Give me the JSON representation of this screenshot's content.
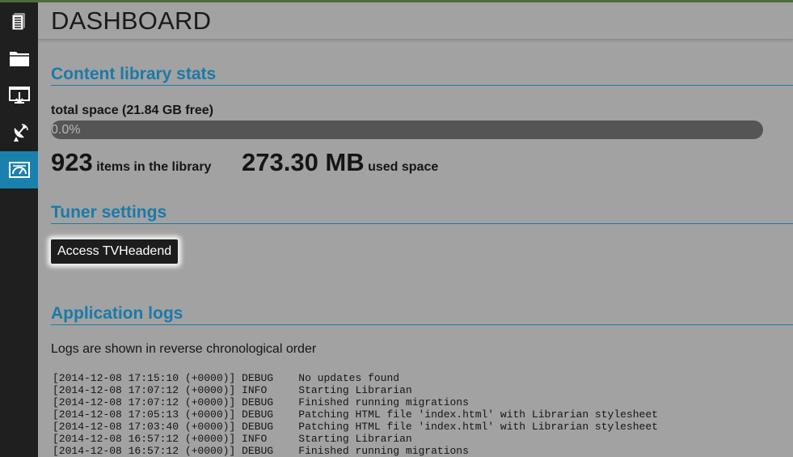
{
  "colors": {
    "accent": "#1b7aa8",
    "sidebar_bg": "#1f1f1f",
    "sidebar_active": "#1a81ad",
    "page_bg": "#a2a2a2",
    "progress_track": "#555555",
    "button_bg": "#1d1d1d"
  },
  "sidebar": {
    "items": [
      {
        "icon": "document-icon",
        "active": false
      },
      {
        "icon": "folder-icon",
        "active": false
      },
      {
        "icon": "screen-download-icon",
        "active": false
      },
      {
        "icon": "satellite-dish-icon",
        "active": false
      },
      {
        "icon": "dashboard-gauge-icon",
        "active": true
      }
    ]
  },
  "header": {
    "title": "DASHBOARD"
  },
  "stats": {
    "heading": "Content library stats",
    "space_label": "total space (21.84 GB free)",
    "progress_value": 0.0,
    "progress_text": "0.0%",
    "items_count": "923",
    "items_label": "items in the library",
    "used_space": "273.30 MB",
    "used_label": "used space"
  },
  "tuner": {
    "heading": "Tuner settings",
    "button_label": "Access TVHeadend"
  },
  "logs": {
    "heading": "Application logs",
    "note": "Logs are shown in reverse chronological order",
    "entries": [
      {
        "timestamp": "[2014-12-08 17:15:10 (+0000)]",
        "level": "DEBUG",
        "message": "No updates found"
      },
      {
        "timestamp": "[2014-12-08 17:07:12 (+0000)]",
        "level": "INFO",
        "message": "Starting Librarian"
      },
      {
        "timestamp": "[2014-12-08 17:07:12 (+0000)]",
        "level": "DEBUG",
        "message": "Finished running migrations"
      },
      {
        "timestamp": "[2014-12-08 17:05:13 (+0000)]",
        "level": "DEBUG",
        "message": "Patching HTML file 'index.html' with Librarian stylesheet"
      },
      {
        "timestamp": "[2014-12-08 17:03:40 (+0000)]",
        "level": "DEBUG",
        "message": "Patching HTML file 'index.html' with Librarian stylesheet"
      },
      {
        "timestamp": "[2014-12-08 16:57:12 (+0000)]",
        "level": "INFO",
        "message": "Starting Librarian"
      },
      {
        "timestamp": "[2014-12-08 16:57:12 (+0000)]",
        "level": "DEBUG",
        "message": "Finished running migrations"
      }
    ]
  }
}
